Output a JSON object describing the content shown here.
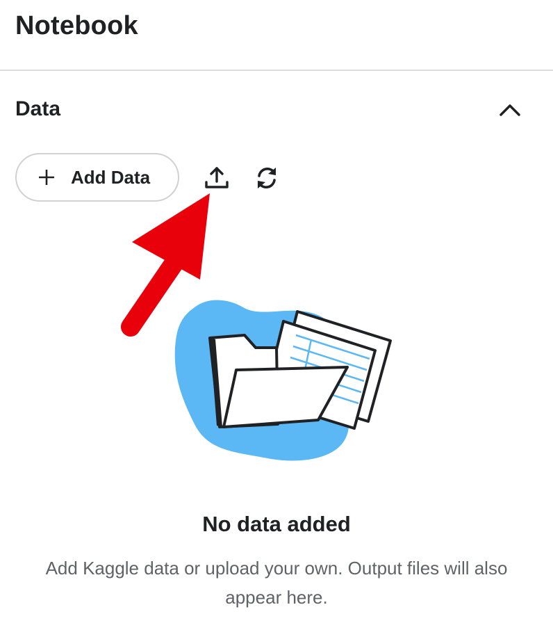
{
  "header": {
    "title": "Notebook"
  },
  "data_section": {
    "title": "Data",
    "collapse_icon": "chevron-up-icon",
    "add_button_label": "Add Data",
    "add_button_icon": "plus-icon",
    "upload_icon": "upload-icon",
    "refresh_icon": "refresh-icon"
  },
  "annotation": {
    "arrow_color": "#e8000b",
    "arrow_icon": "red-arrow-annotation"
  },
  "empty_state": {
    "illustration": "folder-with-documents-illustration",
    "title": "No data added",
    "description": "Add Kaggle data or upload your own. Output files will also appear here."
  },
  "colors": {
    "blob": "#5bb8f4",
    "text": "#202124",
    "muted": "#5f6368",
    "divider": "#dadce0"
  }
}
